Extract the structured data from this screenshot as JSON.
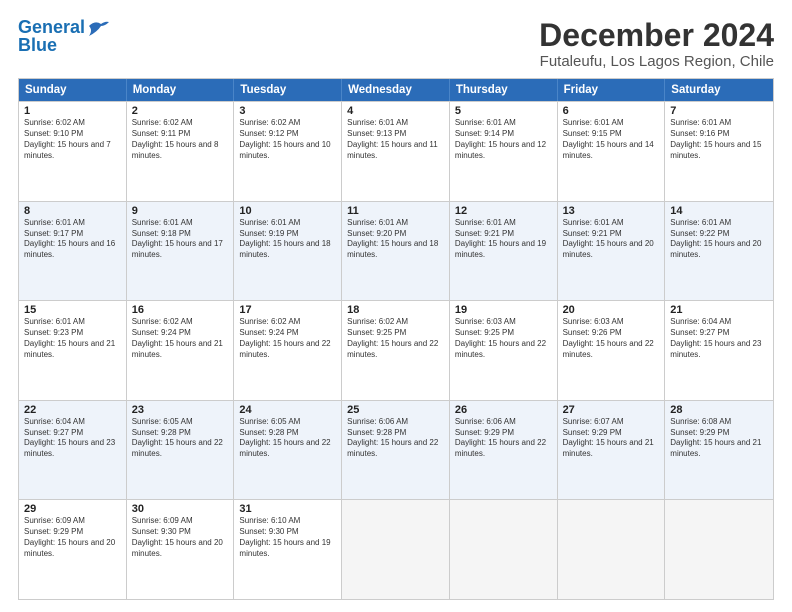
{
  "logo": {
    "line1": "General",
    "line2": "Blue"
  },
  "title": "December 2024",
  "location": "Futaleufu, Los Lagos Region, Chile",
  "days": [
    "Sunday",
    "Monday",
    "Tuesday",
    "Wednesday",
    "Thursday",
    "Friday",
    "Saturday"
  ],
  "weeks": [
    [
      {
        "day": "1",
        "sunrise": "6:02 AM",
        "sunset": "9:10 PM",
        "daylight": "15 hours and 7 minutes."
      },
      {
        "day": "2",
        "sunrise": "6:02 AM",
        "sunset": "9:11 PM",
        "daylight": "15 hours and 8 minutes."
      },
      {
        "day": "3",
        "sunrise": "6:02 AM",
        "sunset": "9:12 PM",
        "daylight": "15 hours and 10 minutes."
      },
      {
        "day": "4",
        "sunrise": "6:01 AM",
        "sunset": "9:13 PM",
        "daylight": "15 hours and 11 minutes."
      },
      {
        "day": "5",
        "sunrise": "6:01 AM",
        "sunset": "9:14 PM",
        "daylight": "15 hours and 12 minutes."
      },
      {
        "day": "6",
        "sunrise": "6:01 AM",
        "sunset": "9:15 PM",
        "daylight": "15 hours and 14 minutes."
      },
      {
        "day": "7",
        "sunrise": "6:01 AM",
        "sunset": "9:16 PM",
        "daylight": "15 hours and 15 minutes."
      }
    ],
    [
      {
        "day": "8",
        "sunrise": "6:01 AM",
        "sunset": "9:17 PM",
        "daylight": "15 hours and 16 minutes."
      },
      {
        "day": "9",
        "sunrise": "6:01 AM",
        "sunset": "9:18 PM",
        "daylight": "15 hours and 17 minutes."
      },
      {
        "day": "10",
        "sunrise": "6:01 AM",
        "sunset": "9:19 PM",
        "daylight": "15 hours and 18 minutes."
      },
      {
        "day": "11",
        "sunrise": "6:01 AM",
        "sunset": "9:20 PM",
        "daylight": "15 hours and 18 minutes."
      },
      {
        "day": "12",
        "sunrise": "6:01 AM",
        "sunset": "9:21 PM",
        "daylight": "15 hours and 19 minutes."
      },
      {
        "day": "13",
        "sunrise": "6:01 AM",
        "sunset": "9:21 PM",
        "daylight": "15 hours and 20 minutes."
      },
      {
        "day": "14",
        "sunrise": "6:01 AM",
        "sunset": "9:22 PM",
        "daylight": "15 hours and 20 minutes."
      }
    ],
    [
      {
        "day": "15",
        "sunrise": "6:01 AM",
        "sunset": "9:23 PM",
        "daylight": "15 hours and 21 minutes."
      },
      {
        "day": "16",
        "sunrise": "6:02 AM",
        "sunset": "9:24 PM",
        "daylight": "15 hours and 21 minutes."
      },
      {
        "day": "17",
        "sunrise": "6:02 AM",
        "sunset": "9:24 PM",
        "daylight": "15 hours and 22 minutes."
      },
      {
        "day": "18",
        "sunrise": "6:02 AM",
        "sunset": "9:25 PM",
        "daylight": "15 hours and 22 minutes."
      },
      {
        "day": "19",
        "sunrise": "6:03 AM",
        "sunset": "9:25 PM",
        "daylight": "15 hours and 22 minutes."
      },
      {
        "day": "20",
        "sunrise": "6:03 AM",
        "sunset": "9:26 PM",
        "daylight": "15 hours and 22 minutes."
      },
      {
        "day": "21",
        "sunrise": "6:04 AM",
        "sunset": "9:27 PM",
        "daylight": "15 hours and 23 minutes."
      }
    ],
    [
      {
        "day": "22",
        "sunrise": "6:04 AM",
        "sunset": "9:27 PM",
        "daylight": "15 hours and 23 minutes."
      },
      {
        "day": "23",
        "sunrise": "6:05 AM",
        "sunset": "9:28 PM",
        "daylight": "15 hours and 22 minutes."
      },
      {
        "day": "24",
        "sunrise": "6:05 AM",
        "sunset": "9:28 PM",
        "daylight": "15 hours and 22 minutes."
      },
      {
        "day": "25",
        "sunrise": "6:06 AM",
        "sunset": "9:28 PM",
        "daylight": "15 hours and 22 minutes."
      },
      {
        "day": "26",
        "sunrise": "6:06 AM",
        "sunset": "9:29 PM",
        "daylight": "15 hours and 22 minutes."
      },
      {
        "day": "27",
        "sunrise": "6:07 AM",
        "sunset": "9:29 PM",
        "daylight": "15 hours and 21 minutes."
      },
      {
        "day": "28",
        "sunrise": "6:08 AM",
        "sunset": "9:29 PM",
        "daylight": "15 hours and 21 minutes."
      }
    ],
    [
      {
        "day": "29",
        "sunrise": "6:09 AM",
        "sunset": "9:29 PM",
        "daylight": "15 hours and 20 minutes."
      },
      {
        "day": "30",
        "sunrise": "6:09 AM",
        "sunset": "9:30 PM",
        "daylight": "15 hours and 20 minutes."
      },
      {
        "day": "31",
        "sunrise": "6:10 AM",
        "sunset": "9:30 PM",
        "daylight": "15 hours and 19 minutes."
      },
      null,
      null,
      null,
      null
    ]
  ]
}
